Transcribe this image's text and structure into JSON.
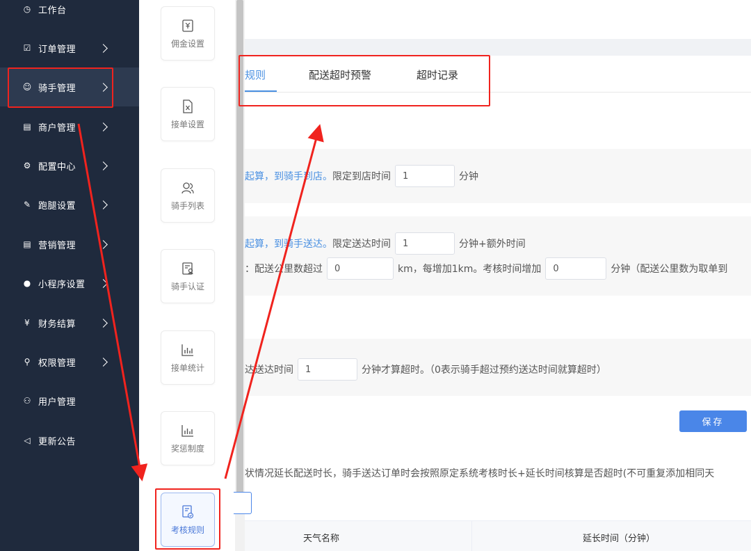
{
  "sidebar": {
    "items": [
      {
        "label": "工作台",
        "icon": "dashboard-icon",
        "glyph": "◷",
        "chevron": false
      },
      {
        "label": "订单管理",
        "icon": "edit-icon",
        "glyph": "☑",
        "chevron": true
      },
      {
        "label": "骑手管理",
        "icon": "smile-icon",
        "glyph": "☺",
        "chevron": true,
        "active": true
      },
      {
        "label": "商户管理",
        "icon": "shop-icon",
        "glyph": "▤",
        "chevron": true
      },
      {
        "label": "配置中心",
        "icon": "gear-icon",
        "glyph": "⚙",
        "chevron": true
      },
      {
        "label": "跑腿设置",
        "icon": "wrench-icon",
        "glyph": "✎",
        "chevron": true
      },
      {
        "label": "营销管理",
        "icon": "store-icon",
        "glyph": "▤",
        "chevron": true
      },
      {
        "label": "小程序设置",
        "icon": "wechat-icon",
        "glyph": "●",
        "chevron": true
      },
      {
        "label": "财务结算",
        "icon": "yen-icon",
        "glyph": "¥",
        "chevron": true
      },
      {
        "label": "权限管理",
        "icon": "search-icon",
        "glyph": "⚲",
        "chevron": true
      },
      {
        "label": "用户管理",
        "icon": "user-icon",
        "glyph": "⚇",
        "chevron": false
      },
      {
        "label": "更新公告",
        "icon": "megaphone-icon",
        "glyph": "◁",
        "chevron": false
      }
    ]
  },
  "submenu": {
    "items": [
      {
        "label": "佣金设置",
        "icon": "commission-icon"
      },
      {
        "label": "接单设置",
        "icon": "excel-file-icon"
      },
      {
        "label": "骑手列表",
        "icon": "users-icon"
      },
      {
        "label": "骑手认证",
        "icon": "certification-icon"
      },
      {
        "label": "接单统计",
        "icon": "bar-chart-icon"
      },
      {
        "label": "奖惩制度",
        "icon": "bar-chart-icon"
      },
      {
        "label": "考核规则",
        "icon": "assessment-icon",
        "active": true
      }
    ]
  },
  "tabs": [
    {
      "label": "规则",
      "active": true
    },
    {
      "label": "配送超时预警"
    },
    {
      "label": "超时记录"
    }
  ],
  "arrival": {
    "prefix_blue": "起算，到骑手到店。",
    "label": "限定到店时间",
    "value": "1",
    "unit": "分钟"
  },
  "delivery": {
    "prefix_blue": "起算，到骑手送达。",
    "label": "限定送达时间",
    "value": "1",
    "unit": "分钟+额外时间",
    "distance_prefix": "：配送公里数超过",
    "distance_value": "0",
    "distance_mid": "km，每增加1km。考核时间增加",
    "extra_value": "0",
    "distance_suffix": "分钟（配送公里数为取单到"
  },
  "overtime": {
    "prefix": "达送达时间",
    "value": "1",
    "suffix": "分钟才算超时。（0表示骑手超过预约送达时间就算超时）"
  },
  "save_label": "保存",
  "note": "状情况延长配送时长，骑手送达订单时会按照原定系统考核时长+延长时间核算是否超时(不可重复添加相同天",
  "table": {
    "headers": [
      "天气名称",
      "延长时间（分钟）"
    ]
  },
  "colors": {
    "sidebar_bg": "#1f2a3d",
    "accent": "#4a90e2",
    "annotation_red": "#f0231e"
  }
}
